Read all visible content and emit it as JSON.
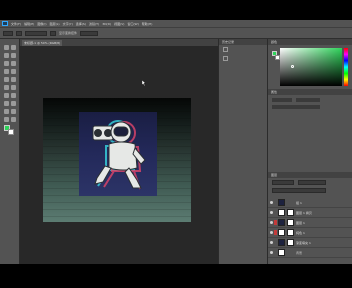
{
  "menu": {
    "items": [
      "文件(F)",
      "编辑(E)",
      "图像(I)",
      "图层(L)",
      "文字(Y)",
      "选择(S)",
      "滤镜(T)",
      "3D(D)",
      "视图(V)",
      "窗口(W)",
      "帮助(H)"
    ]
  },
  "options": {
    "labels": [
      "显示变换控件"
    ]
  },
  "document": {
    "tab_label": "未标题-1 @ 50% (RGB/8)"
  },
  "panels": {
    "history_label": "历史记录",
    "color_label": "颜色",
    "properties_label": "属性",
    "layers_label": "图层"
  },
  "layers": [
    {
      "name": "组 1"
    },
    {
      "name": "图层 1 拷贝"
    },
    {
      "name": "图层 1"
    },
    {
      "name": "纯色 1"
    },
    {
      "name": "渐变填充 1"
    },
    {
      "name": "背景"
    }
  ],
  "colors": {
    "foreground": "#2ED35A",
    "background": "#FFFFFF",
    "accent": "#31A8FF"
  }
}
